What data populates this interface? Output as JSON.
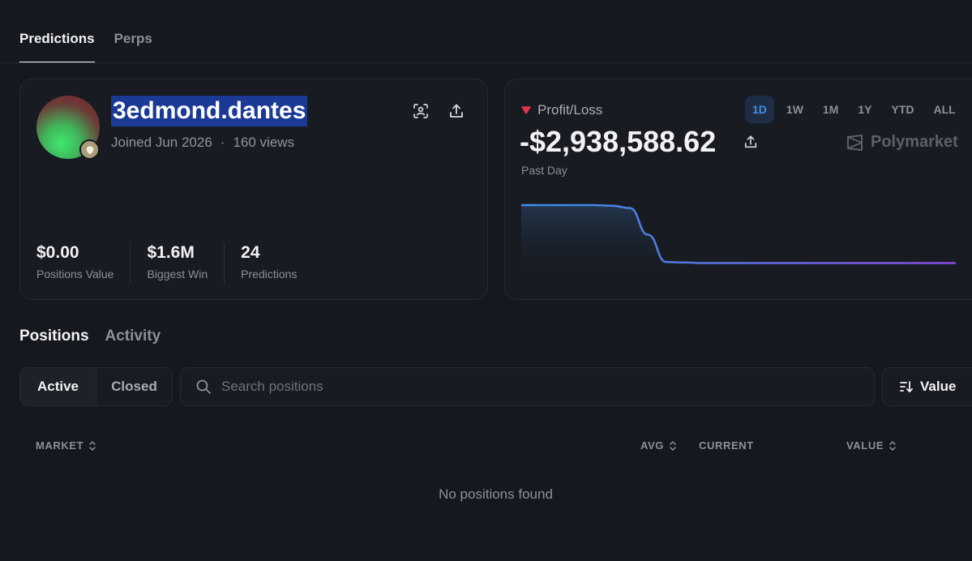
{
  "top_tabs": [
    {
      "label": "Predictions",
      "active": true
    },
    {
      "label": "Perps",
      "active": false
    }
  ],
  "profile": {
    "username": "3edmond.dantes",
    "joined": "Joined Jun 2026",
    "separator": "·",
    "views": "160 views",
    "stats": [
      {
        "value": "$0.00",
        "label": "Positions Value"
      },
      {
        "value": "$1.6M",
        "label": "Biggest Win"
      },
      {
        "value": "24",
        "label": "Predictions"
      }
    ]
  },
  "pnl": {
    "title": "Profit/Loss",
    "value": "-$2,938,588.62",
    "period": "Past Day",
    "ranges": [
      "1D",
      "1W",
      "1M",
      "1Y",
      "YTD",
      "ALL"
    ],
    "active_range": "1D",
    "brand": "Polymarket",
    "indicator_color": "#e0354a"
  },
  "chart_data": {
    "type": "area",
    "values": [
      1.0,
      1.0,
      1.0,
      1.0,
      1.0,
      0.99,
      0.95,
      0.5,
      0.04,
      0.03,
      0.02,
      0.02,
      0.02,
      0.02,
      0.02,
      0.02,
      0.02,
      0.02,
      0.02,
      0.02,
      0.02,
      0.02,
      0.02,
      0.02,
      0.02
    ],
    "title": "",
    "xlabel": "",
    "ylabel": "",
    "grid": false,
    "colors": {
      "start": "#3b8fe6",
      "end": "#8b4de6"
    }
  },
  "positions": {
    "tabs": [
      {
        "label": "Positions",
        "active": true
      },
      {
        "label": "Activity",
        "active": false
      }
    ],
    "filter": [
      "Active",
      "Closed"
    ],
    "search_placeholder": "Search positions",
    "sort_label": "Value",
    "columns": {
      "market": "MARKET",
      "avg": "AVG",
      "current": "CURRENT",
      "value": "VALUE"
    },
    "empty": "No positions found"
  }
}
